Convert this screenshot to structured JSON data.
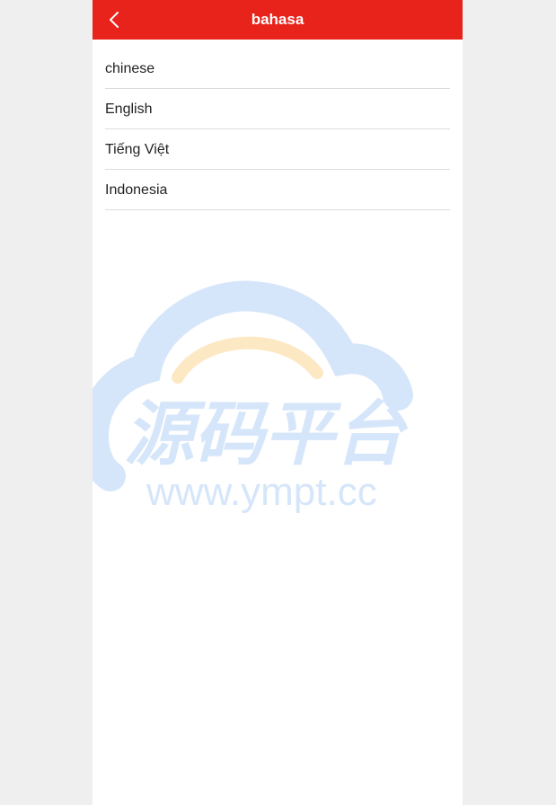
{
  "header": {
    "title": "bahasa",
    "back_icon": "chevron-left-icon"
  },
  "languages": [
    {
      "label": "chinese"
    },
    {
      "label": "English"
    },
    {
      "label": "Tiếng Việt"
    },
    {
      "label": "Indonesia"
    }
  ],
  "watermark": {
    "chinese_text": "源码平台",
    "url_text": "www.ympt.cc"
  },
  "colors": {
    "header_bg": "#e8231b",
    "header_text": "#ffffff",
    "page_bg": "#efefef",
    "panel_bg": "#ffffff",
    "watermark_blue": "#d6e6fa",
    "watermark_orange": "#fde8c4"
  }
}
